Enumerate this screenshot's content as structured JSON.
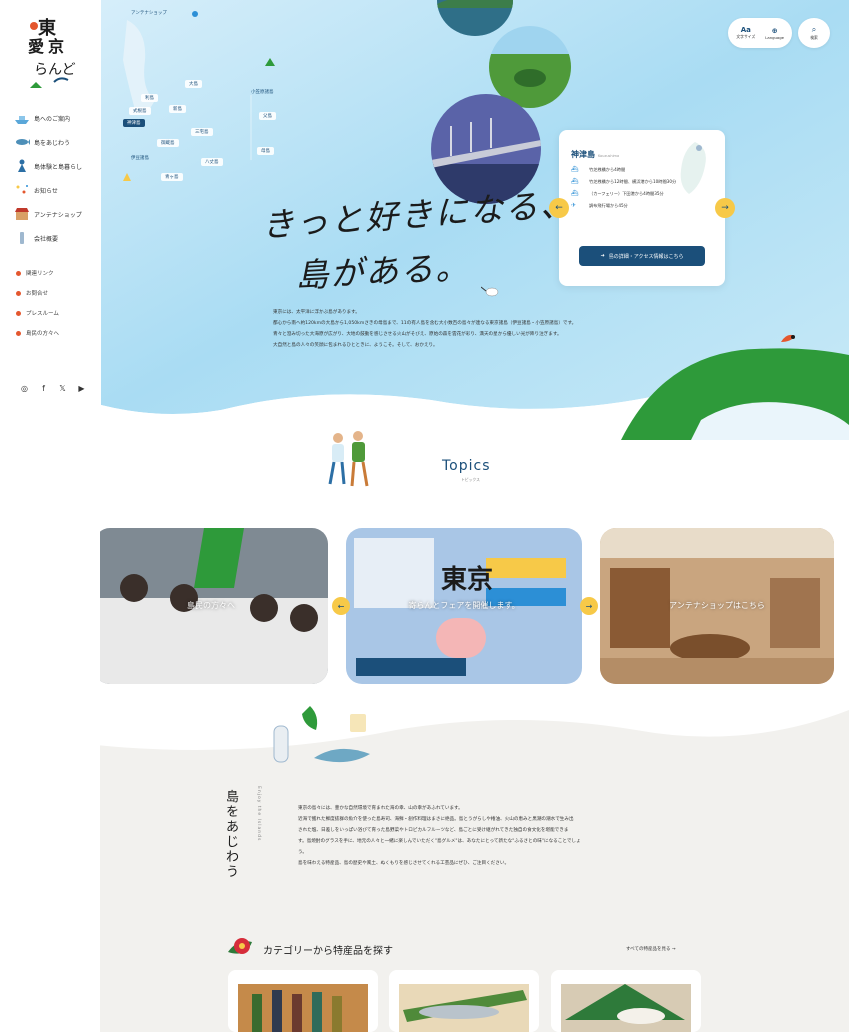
{
  "sidebar": {
    "nav": [
      {
        "label": "島へのご案内",
        "icon": "ship-icon"
      },
      {
        "label": "島をあじわう",
        "icon": "fish-icon"
      },
      {
        "label": "島体験と島暮らし",
        "icon": "person-icon"
      },
      {
        "label": "お知らせ",
        "icon": "sparkle-icon"
      },
      {
        "label": "アンテナショップ",
        "icon": "shop-icon"
      },
      {
        "label": "会社概要",
        "icon": "bottle-icon"
      }
    ],
    "subnav": [
      "関連リンク",
      "お問合せ",
      "プレスルーム",
      "島民の方々へ"
    ],
    "social": [
      "instagram-icon",
      "facebook-icon",
      "x-icon",
      "youtube-icon"
    ]
  },
  "header": {
    "font_size_label": "文字サイズ",
    "font_size_glyph": "Aa",
    "language_label": "Language",
    "search_label": "検索"
  },
  "map": {
    "antenna_shop": "アンテナショップ",
    "islands": [
      "大島",
      "利島",
      "新島",
      "式根島",
      "神津島",
      "三宅島",
      "御蔵島",
      "八丈島",
      "青ヶ島"
    ],
    "active_island": "神津島",
    "group_izu": "伊豆諸島",
    "group_ogasawara": "小笠原諸島",
    "ogasawara_islands": [
      "父島",
      "母島"
    ]
  },
  "hero": {
    "tagline_line1": "きっと好きになる、",
    "tagline_line2": "島がある。",
    "text": [
      "東京には、太平洋に浮かぶ島があります。",
      "都心から南へ約120kmの大島から1,050kmさきの母島まで、11の有人島を含む大小数百の島々が連なる東京諸島（伊豆諸島・小笠原諸島）です。",
      "青々と澄み切った大海原が広がり、大地の鼓動を感じさせる火山がそびえ、原始の森を雲花が彩り、満天の星から優しい光が降り注ぎます。",
      "大自然と島の人々の笑顔に包まれるひとときに、ようこそ。そして、おかえり。"
    ]
  },
  "island_card": {
    "name": "神津島",
    "roman": "Kouzushima",
    "routes": [
      {
        "icon": "ship-icon",
        "text": "竹芝桟橋から4時間"
      },
      {
        "icon": "ship-icon",
        "text": "竹芝桟橋から12時間、横浜港から10時間30分"
      },
      {
        "icon": "ship-icon",
        "text": "（カーフェリー）下田港から4時間35分"
      },
      {
        "icon": "plane-icon",
        "text": "調布飛行場から45分"
      }
    ],
    "access_button": "島の詳細・アクセス情報はこちら"
  },
  "topics": {
    "title": "Topics",
    "subtitle": "トピックス",
    "cards": [
      "島民の方々へ",
      "寄らんとフェアを開催します。",
      "アンテナショップはこちら"
    ]
  },
  "taste": {
    "title": "島をあじわう",
    "title_en": "Enjoy the Islands",
    "text": [
      "東京の島々には、豊かな自然環境で育まれた海の幸、山の幸があふれています。",
      "近海で獲れた鮮度抜群の魚介を使った島寿司、海鮮・創作料理はまさに絶品。島とうがらしや椿油、火山の恵みと黒潮の潮水で生み出",
      "された塩、日差しをいっぱい浴びて育った島野菜やトロピカルフルーツなど、島ごとに受け継がれてきた独自の食文化を堪能できま",
      "す。島焼酎のグラスを手に、地元の人々と一緒に楽しんでいただく\"島グルメ\"は、あなたにとって新たな\"ふるさとの味\"になることでしょ",
      "う。",
      "島を味わえる特産品、島の歴史や風土、ぬくもりを感じさせてくれる工芸品にぜひ、ご注目ください。"
    ],
    "category_title": "カテゴリーから特産品を探す",
    "category_link": "すべての特産品を見る →"
  },
  "colors": {
    "primary": "#1b4f7a",
    "accent_yellow": "#f7c948",
    "accent_red": "#e4572e",
    "sky": "#bfe6f8",
    "green": "#2e9a3a"
  }
}
